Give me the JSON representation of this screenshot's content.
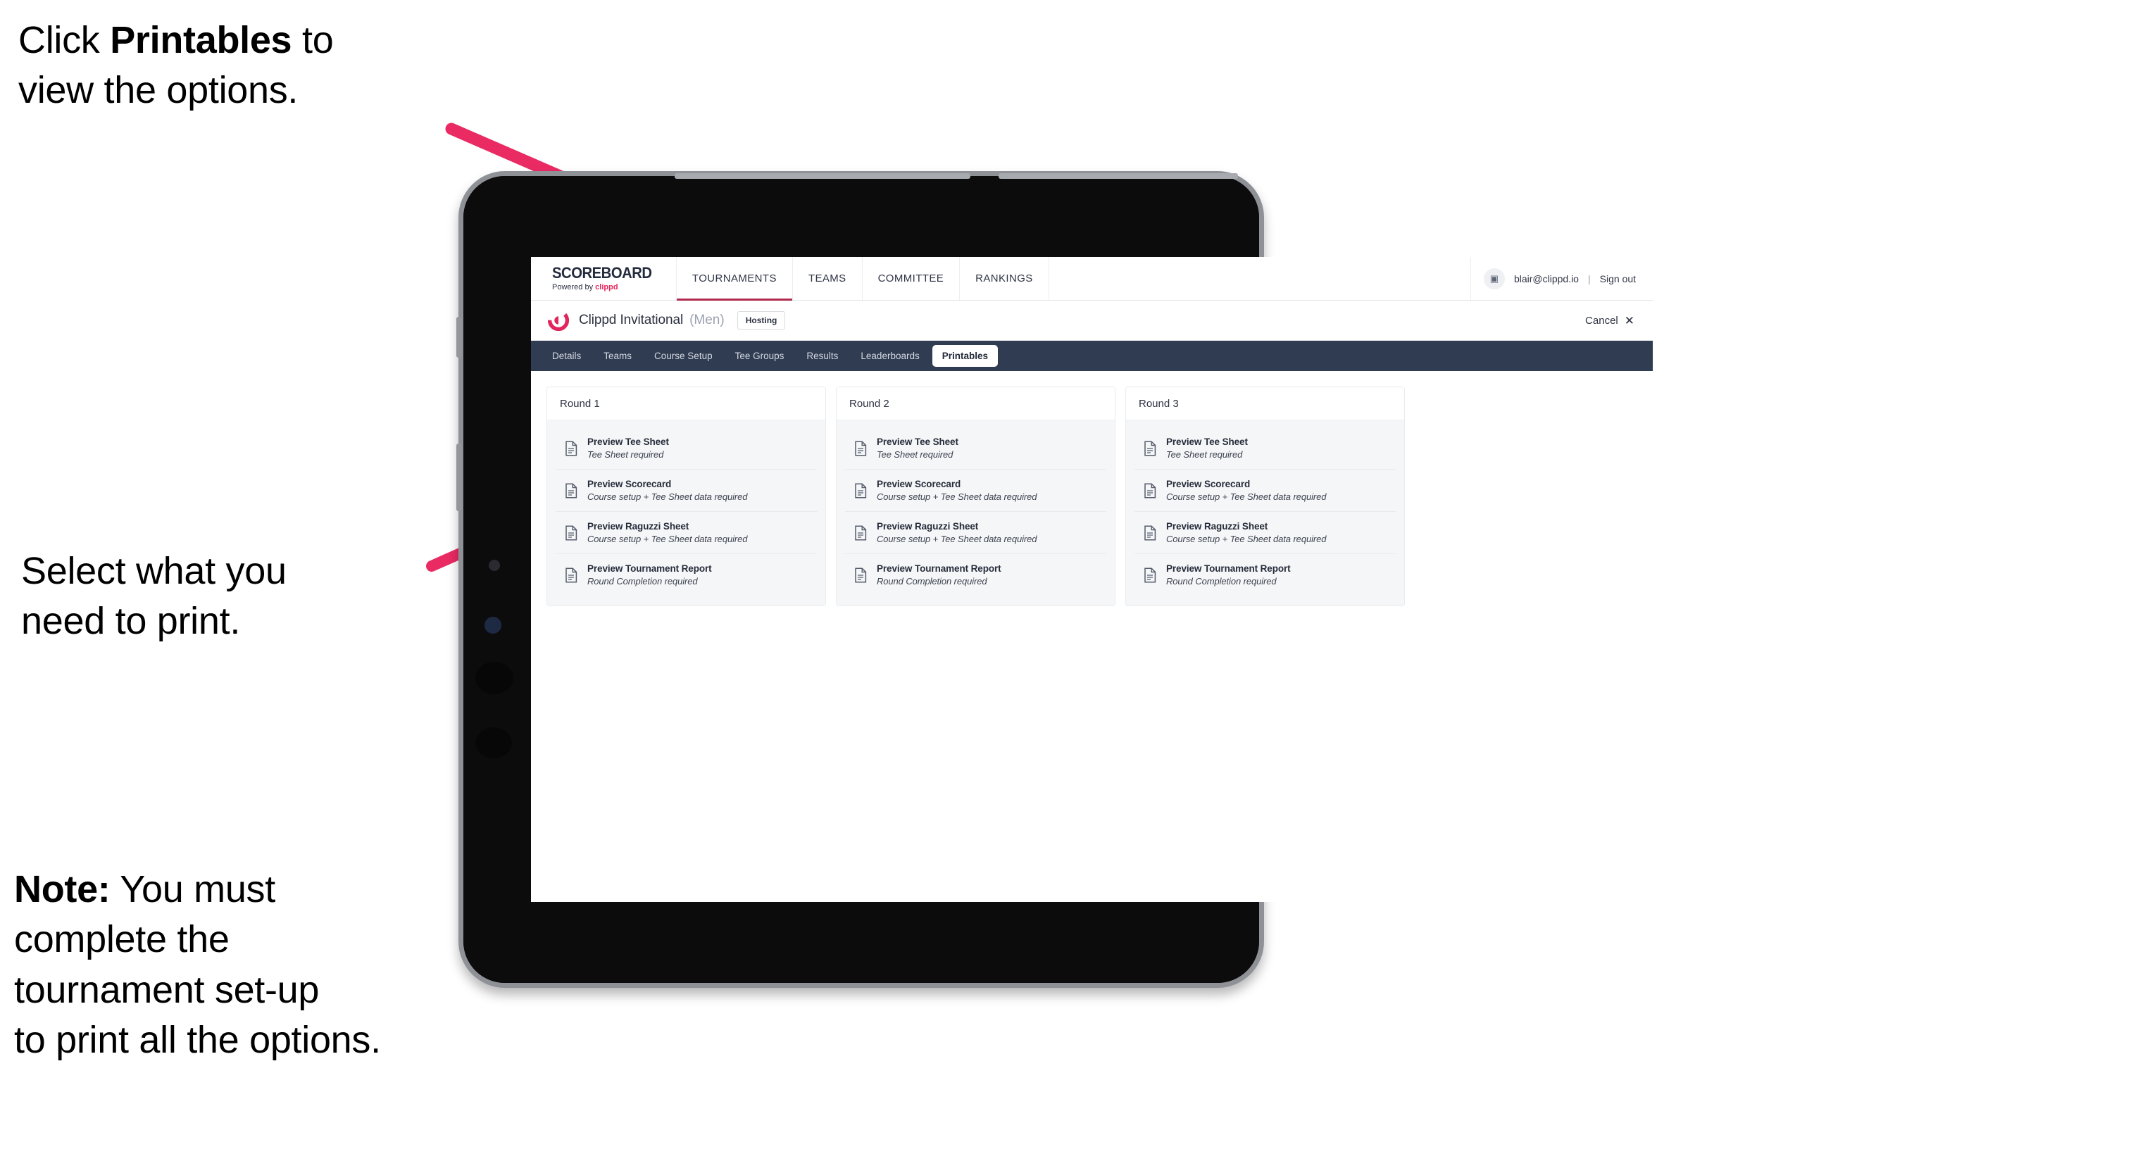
{
  "annotations": {
    "click_printables": {
      "prefix": "Click ",
      "bold": "Printables",
      "suffix": " to\nview the options."
    },
    "select_print": "Select what you\n need to print.",
    "note": {
      "bold": "Note:",
      "rest": " You must\ncomplete the\ntournament set-up\nto print all the options."
    }
  },
  "colors": {
    "accent_pink": "#ea2a63",
    "brand_red": "#e5285f",
    "subnav_bg": "#303c52",
    "tab_active_underline": "#b02a4e",
    "panel_gray": "#f5f6f8"
  },
  "app": {
    "brand": {
      "title": "SCOREBOARD",
      "powered_prefix": "Powered by ",
      "powered_brand": "clippd"
    },
    "top_nav": [
      {
        "label": "TOURNAMENTS",
        "active": true
      },
      {
        "label": "TEAMS",
        "active": false
      },
      {
        "label": "COMMITTEE",
        "active": false
      },
      {
        "label": "RANKINGS",
        "active": false
      }
    ],
    "account": {
      "avatar_glyph": "▣",
      "email": "blair@clippd.io",
      "separator": "|",
      "sign_out": "Sign out"
    },
    "tournament_bar": {
      "logo_letter": "C",
      "name": "Clippd Invitational",
      "gender": "(Men)",
      "badge": "Hosting",
      "cancel": "Cancel",
      "cancel_icon": "✕"
    },
    "sub_nav": [
      {
        "label": "Details",
        "active": false
      },
      {
        "label": "Teams",
        "active": false
      },
      {
        "label": "Course Setup",
        "active": false
      },
      {
        "label": "Tee Groups",
        "active": false
      },
      {
        "label": "Results",
        "active": false
      },
      {
        "label": "Leaderboards",
        "active": false
      },
      {
        "label": "Printables",
        "active": true
      }
    ],
    "rounds": [
      {
        "title": "Round 1",
        "items": [
          {
            "title": "Preview Tee Sheet",
            "sub": "Tee Sheet required"
          },
          {
            "title": "Preview Scorecard",
            "sub": "Course setup + Tee Sheet data required"
          },
          {
            "title": "Preview Raguzzi Sheet",
            "sub": "Course setup + Tee Sheet data required"
          },
          {
            "title": "Preview Tournament Report",
            "sub": "Round Completion required"
          }
        ]
      },
      {
        "title": "Round 2",
        "items": [
          {
            "title": "Preview Tee Sheet",
            "sub": "Tee Sheet required"
          },
          {
            "title": "Preview Scorecard",
            "sub": "Course setup + Tee Sheet data required"
          },
          {
            "title": "Preview Raguzzi Sheet",
            "sub": "Course setup + Tee Sheet data required"
          },
          {
            "title": "Preview Tournament Report",
            "sub": "Round Completion required"
          }
        ]
      },
      {
        "title": "Round 3",
        "items": [
          {
            "title": "Preview Tee Sheet",
            "sub": "Tee Sheet required"
          },
          {
            "title": "Preview Scorecard",
            "sub": "Course setup + Tee Sheet data required"
          },
          {
            "title": "Preview Raguzzi Sheet",
            "sub": "Course setup + Tee Sheet data required"
          },
          {
            "title": "Preview Tournament Report",
            "sub": "Round Completion required"
          }
        ]
      }
    ]
  }
}
